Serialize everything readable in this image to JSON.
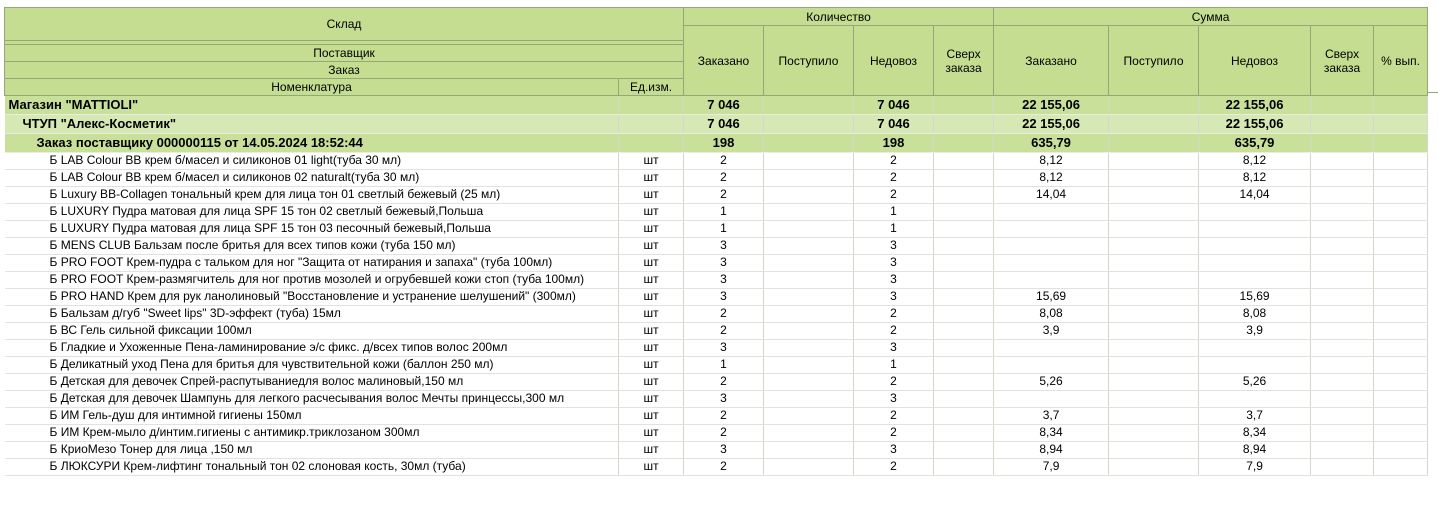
{
  "header": {
    "sklad": "Склад",
    "postavshik": "Поставщик",
    "zakaz": "Заказ",
    "nomenklatura": "Номенклатура",
    "ed_izm": "Ед.изм.",
    "kolichestvo": "Количество",
    "summa": "Сумма",
    "zakazano": "Заказано",
    "postupilo": "Поступило",
    "nedovoz": "Недовоз",
    "sverh_zakaza": "Сверх заказа",
    "pct_vyp": "% вып."
  },
  "groups": [
    {
      "name": "Магазин \"MATTIOLI\"",
      "qty_ordered": "7 046",
      "qty_received": "",
      "qty_short": "7 046",
      "qty_over": "",
      "sum_ordered": "22 155,06",
      "sum_received": "",
      "sum_short": "22 155,06",
      "sum_over": "",
      "pct": ""
    },
    {
      "name": "ЧТУП  \"Алекс-Косметик\"",
      "qty_ordered": "7 046",
      "qty_received": "",
      "qty_short": "7 046",
      "qty_over": "",
      "sum_ordered": "22 155,06",
      "sum_received": "",
      "sum_short": "22 155,06",
      "sum_over": "",
      "pct": ""
    },
    {
      "name": "Заказ поставщику 000000115 от 14.05.2024 18:52:44",
      "qty_ordered": "198",
      "qty_received": "",
      "qty_short": "198",
      "qty_over": "",
      "sum_ordered": "635,79",
      "sum_received": "",
      "sum_short": "635,79",
      "sum_over": "",
      "pct": ""
    }
  ],
  "items": [
    {
      "name": "Б LAB Colour BB крем б/масел и силиконов 01 light(туба 30 мл)",
      "unit": "шт",
      "qty": "2",
      "short": "2",
      "sum": "8,12",
      "sum_short": "8,12"
    },
    {
      "name": "Б LAB Colour BB крем б/масел и силиконов 02 naturalt(туба 30 мл)",
      "unit": "шт",
      "qty": "2",
      "short": "2",
      "sum": "8,12",
      "sum_short": "8,12"
    },
    {
      "name": "Б Luxury BB-Collagen тональный крем для лица тон 01 светлый бежевый (25 мл)",
      "unit": "шт",
      "qty": "2",
      "short": "2",
      "sum": "14,04",
      "sum_short": "14,04"
    },
    {
      "name": "Б LUXURY Пудра матовая для лица SPF 15 тон 02 светлый бежевый,Польша",
      "unit": "шт",
      "qty": "1",
      "short": "1",
      "sum": "",
      "sum_short": ""
    },
    {
      "name": "Б LUXURY Пудра матовая для лица SPF 15 тон 03 песочный бежевый,Польша",
      "unit": "шт",
      "qty": "1",
      "short": "1",
      "sum": "",
      "sum_short": ""
    },
    {
      "name": "Б MENS CLUB Бальзам после бритья для всех типов кожи (туба 150 мл)",
      "unit": "шт",
      "qty": "3",
      "short": "3",
      "sum": "",
      "sum_short": ""
    },
    {
      "name": "Б PRO FOOT Крем-пудра с тальком для ног \"Защита от натирания и запаха\" (туба 100мл)",
      "unit": "шт",
      "qty": "3",
      "short": "3",
      "sum": "",
      "sum_short": ""
    },
    {
      "name": "Б PRO FOOT Крем-размягчитель для ног против мозолей и огрубевшей кожи стоп (туба 100мл)",
      "unit": "шт",
      "qty": "3",
      "short": "3",
      "sum": "",
      "sum_short": "",
      "wrap": true
    },
    {
      "name": "Б PRO HAND Крем для рук ланолиновый \"Восстановление и устранение шелушений\" (300мл)",
      "unit": "шт",
      "qty": "3",
      "short": "3",
      "sum": "15,69",
      "sum_short": "15,69",
      "wrap": true
    },
    {
      "name": "Б Бальзам д/губ \"Sweet lips\" 3D-эффект (туба) 15мл",
      "unit": "шт",
      "qty": "2",
      "short": "2",
      "sum": "8,08",
      "sum_short": "8,08"
    },
    {
      "name": "Б ВС Гель сильной фиксации 100мл",
      "unit": "шт",
      "qty": "2",
      "short": "2",
      "sum": "3,9",
      "sum_short": "3,9"
    },
    {
      "name": "Б Гладкие и Ухоженные Пена-ламинирование э/с фикс. д/всех типов волос 200мл",
      "unit": "шт",
      "qty": "3",
      "short": "3",
      "sum": "",
      "sum_short": ""
    },
    {
      "name": "Б Деликатный уход Пена для бритья для чувствительной кожи (баллон 250 мл)",
      "unit": "шт",
      "qty": "1",
      "short": "1",
      "sum": "",
      "sum_short": ""
    },
    {
      "name": "Б Детская для девочек Спрей-распутываниедля волос малиновый,150 мл",
      "unit": "шт",
      "qty": "2",
      "short": "2",
      "sum": "5,26",
      "sum_short": "5,26"
    },
    {
      "name": "Б Детская для девочек Шампунь для легкого расчесывания волос Мечты принцессы,300 мл",
      "unit": "шт",
      "qty": "3",
      "short": "3",
      "sum": "",
      "sum_short": ""
    },
    {
      "name": "Б ИМ Гель-душ для интимной гигиены 150мл",
      "unit": "шт",
      "qty": "2",
      "short": "2",
      "sum": "3,7",
      "sum_short": "3,7"
    },
    {
      "name": "Б ИМ Крем-мыло д/интим.гигиены с антимикр.триклозаном 300мл",
      "unit": "шт",
      "qty": "2",
      "short": "2",
      "sum": "8,34",
      "sum_short": "8,34"
    },
    {
      "name": "Б КриоМезо Тонер для лица ,150 мл",
      "unit": "шт",
      "qty": "3",
      "short": "3",
      "sum": "8,94",
      "sum_short": "8,94"
    },
    {
      "name": "Б ЛЮКСУРИ Крем-лифтинг тональный тон 02 слоновая кость, 30мл (туба)",
      "unit": "шт",
      "qty": "2",
      "short": "2",
      "sum": "7,9",
      "sum_short": "7,9"
    }
  ]
}
